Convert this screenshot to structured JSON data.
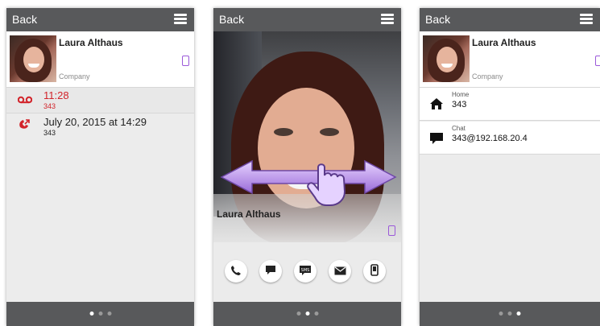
{
  "screens": [
    {
      "back_label": "Back",
      "contact": {
        "name": "Laura Althaus",
        "company": "Company"
      },
      "history": [
        {
          "icon": "voicemail-icon",
          "title": "11:28",
          "sub": "343",
          "color": "#d2232a"
        },
        {
          "icon": "missed-call-icon",
          "title": "July 20, 2015 at 14:29",
          "sub": "343",
          "color": "#222222"
        }
      ],
      "active_page": 0
    },
    {
      "back_label": "Back",
      "contact": {
        "name": "Laura Althaus"
      },
      "actions": [
        {
          "name": "call",
          "icon": "phone-icon",
          "glyph": "✆"
        },
        {
          "name": "chat",
          "icon": "chat-icon",
          "glyph": "■"
        },
        {
          "name": "sms",
          "icon": "sms-icon",
          "glyph": "SMS"
        },
        {
          "name": "email",
          "icon": "mail-icon",
          "glyph": "✉"
        },
        {
          "name": "mobile",
          "icon": "mobile-phone-icon",
          "glyph": "▯"
        }
      ],
      "active_page": 1
    },
    {
      "back_label": "Back",
      "contact": {
        "name": "Laura Althaus",
        "company": "Company"
      },
      "details": [
        {
          "icon": "home-icon",
          "label": "Home",
          "value": "343"
        },
        {
          "icon": "chat-icon",
          "label": "Chat",
          "value": "343@192.168.20.4"
        }
      ],
      "active_page": 2
    }
  ],
  "accent_color": "#9b59d9",
  "bar_color": "#58595b"
}
